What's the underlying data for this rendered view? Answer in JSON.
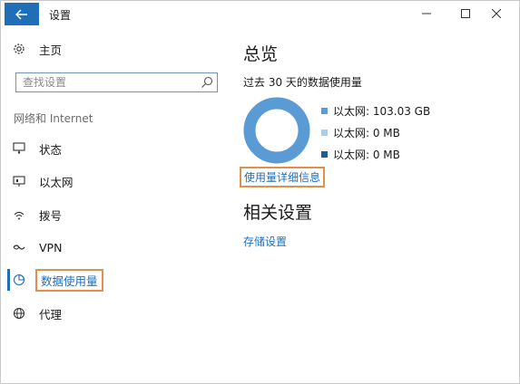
{
  "window": {
    "title": "设置"
  },
  "sidebar": {
    "home_label": "主页",
    "search_placeholder": "查找设置",
    "section_label": "网络和 Internet",
    "items": [
      {
        "label": "状态"
      },
      {
        "label": "以太网"
      },
      {
        "label": "拨号"
      },
      {
        "label": "VPN"
      },
      {
        "label": "数据使用量",
        "active": true
      },
      {
        "label": "代理"
      }
    ]
  },
  "overview": {
    "title": "总览",
    "subtitle": "过去 30 天的数据使用量",
    "legend": [
      {
        "label": "以太网: 103.03 GB",
        "color": "#5b9bd5"
      },
      {
        "label": "以太网: 0 MB",
        "color": "#a9cde9"
      },
      {
        "label": "以太网: 0 MB",
        "color": "#1f5f8f"
      }
    ],
    "details_link": "使用量详细信息"
  },
  "related": {
    "title": "相关设置",
    "storage_link": "存储设置"
  },
  "chart_data": {
    "type": "pie",
    "categories": [
      "以太网",
      "以太网",
      "以太网"
    ],
    "values": [
      103.03,
      0,
      0
    ],
    "unit": "GB"
  },
  "colors": {
    "accent": "#1f6fb8",
    "highlight_border": "#e0904a",
    "donut_primary": "#5b9bd5"
  }
}
